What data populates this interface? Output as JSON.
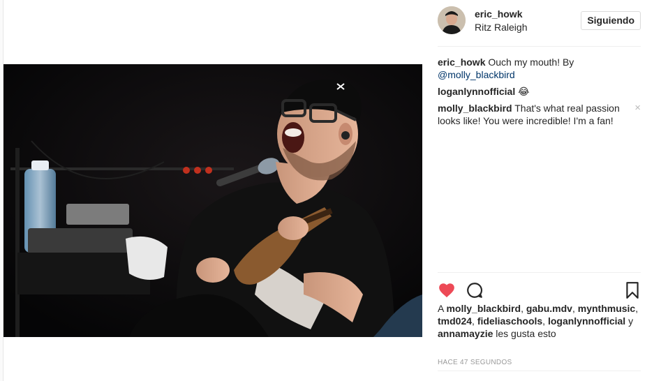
{
  "post": {
    "author": "eric_howk",
    "location": "Ritz Raleigh",
    "follow_label": "Siguiendo",
    "caption": {
      "user": "eric_howk",
      "text": " Ouch my mouth! By ",
      "mention": "@molly_blackbird"
    },
    "comments": [
      {
        "user": "loganlynnofficial",
        "text": " 😂"
      },
      {
        "user": "molly_blackbird",
        "text": " That's what real passion looks like! You were incredible! I'm a fan!",
        "close": "×"
      }
    ],
    "likes": {
      "prefix": "A ",
      "u1": "molly_blackbird",
      "s1": ", ",
      "u2": "gabu.mdv",
      "s2": ", ",
      "u3": "mynthmusic",
      "s3": ", ",
      "u4": "tmd024",
      "s4": ", ",
      "u5": "fideliaschools",
      "s5": ", ",
      "u6": "loganlynnofficial",
      "s6": " y ",
      "u7": "annamayzie",
      "suffix": " les gusta esto"
    },
    "timestamp": "HACE 47 SEGUNDOS",
    "liked": true,
    "colors": {
      "heart": "#ed4956",
      "mention": "#003569"
    }
  },
  "icons": {
    "like": "heart-icon",
    "comment": "comment-bubble-icon",
    "save": "bookmark-icon",
    "dismiss": "close-icon"
  }
}
